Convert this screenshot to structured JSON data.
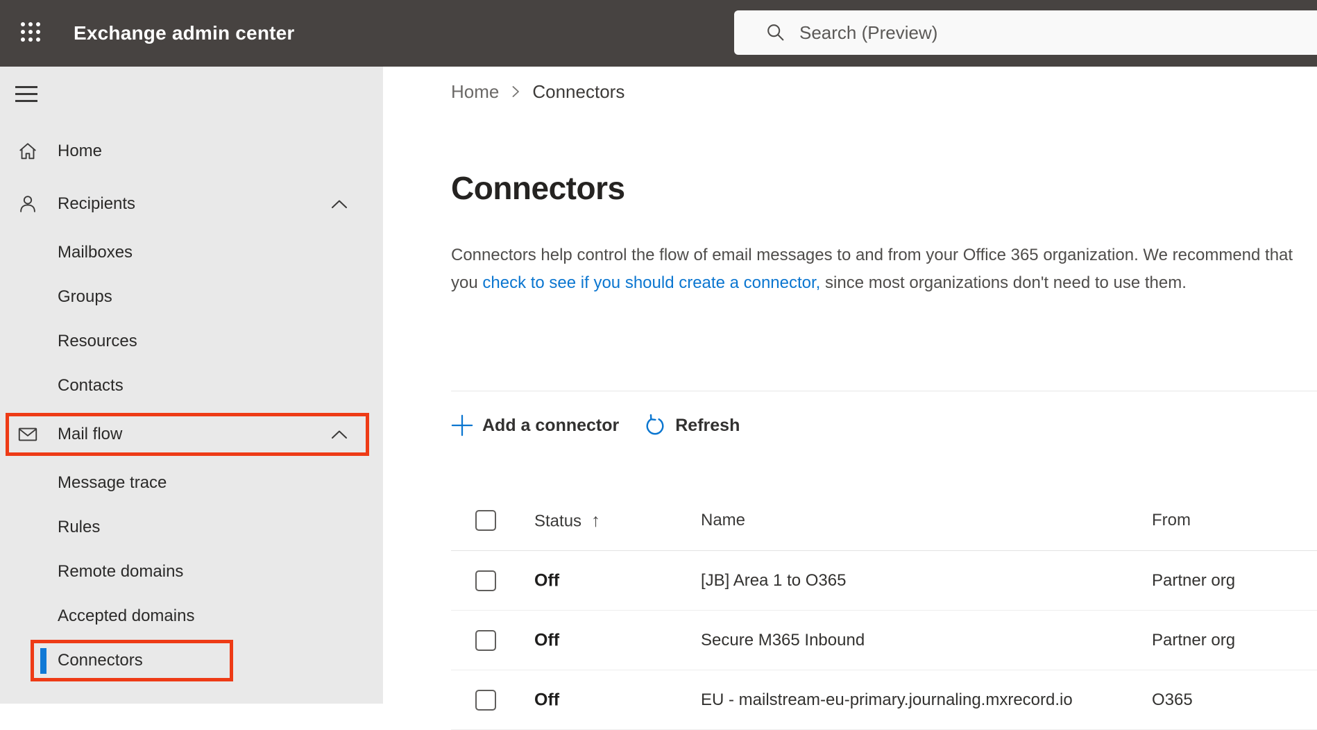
{
  "topbar": {
    "app_title": "Exchange admin center",
    "search_placeholder": "Search (Preview)",
    "icons": {
      "waffle": "app-launcher-grid",
      "search": "magnifier"
    }
  },
  "sidebar": {
    "items": [
      {
        "label": "Home",
        "type": "top",
        "icon": "home"
      },
      {
        "label": "Recipients",
        "type": "top",
        "icon": "person",
        "expanded": true
      },
      {
        "label": "Mailboxes",
        "type": "sub"
      },
      {
        "label": "Groups",
        "type": "sub"
      },
      {
        "label": "Resources",
        "type": "sub"
      },
      {
        "label": "Contacts",
        "type": "sub"
      },
      {
        "label": "Mail flow",
        "type": "top",
        "icon": "envelope",
        "expanded": true,
        "annotated": true
      },
      {
        "label": "Message trace",
        "type": "sub"
      },
      {
        "label": "Rules",
        "type": "sub"
      },
      {
        "label": "Remote domains",
        "type": "sub"
      },
      {
        "label": "Accepted domains",
        "type": "sub"
      },
      {
        "label": "Connectors",
        "type": "sub",
        "selected": true,
        "annotated": true
      }
    ]
  },
  "breadcrumb": {
    "items": [
      "Home",
      "Connectors"
    ]
  },
  "page": {
    "title": "Connectors",
    "description_before": "Connectors help control the flow of email messages to and from your Office 365 organization. We recommend that you ",
    "description_link": "check to see if you should create a connector,",
    "description_after": " since most organizations don't need to use them."
  },
  "toolbar": {
    "add_label": "Add a connector",
    "refresh_label": "Refresh"
  },
  "table": {
    "headers": {
      "status": "Status",
      "name": "Name",
      "from": "From"
    },
    "sort_icon": "↑",
    "rows": [
      {
        "status": "Off",
        "name": "[JB] Area 1 to O365",
        "from": "Partner org"
      },
      {
        "status": "Off",
        "name": "Secure M365 Inbound",
        "from": "Partner org"
      },
      {
        "status": "Off",
        "name": "EU - mailstream-eu-primary.journaling.mxrecord.io",
        "from": "O365"
      }
    ]
  },
  "colors": {
    "topbar_bg": "#474341",
    "sidebar_bg": "#e9e9e9",
    "accent_blue": "#0b76d0",
    "selected_indicator_blue": "#1079d6",
    "annotation_red": "#ee3b16"
  }
}
